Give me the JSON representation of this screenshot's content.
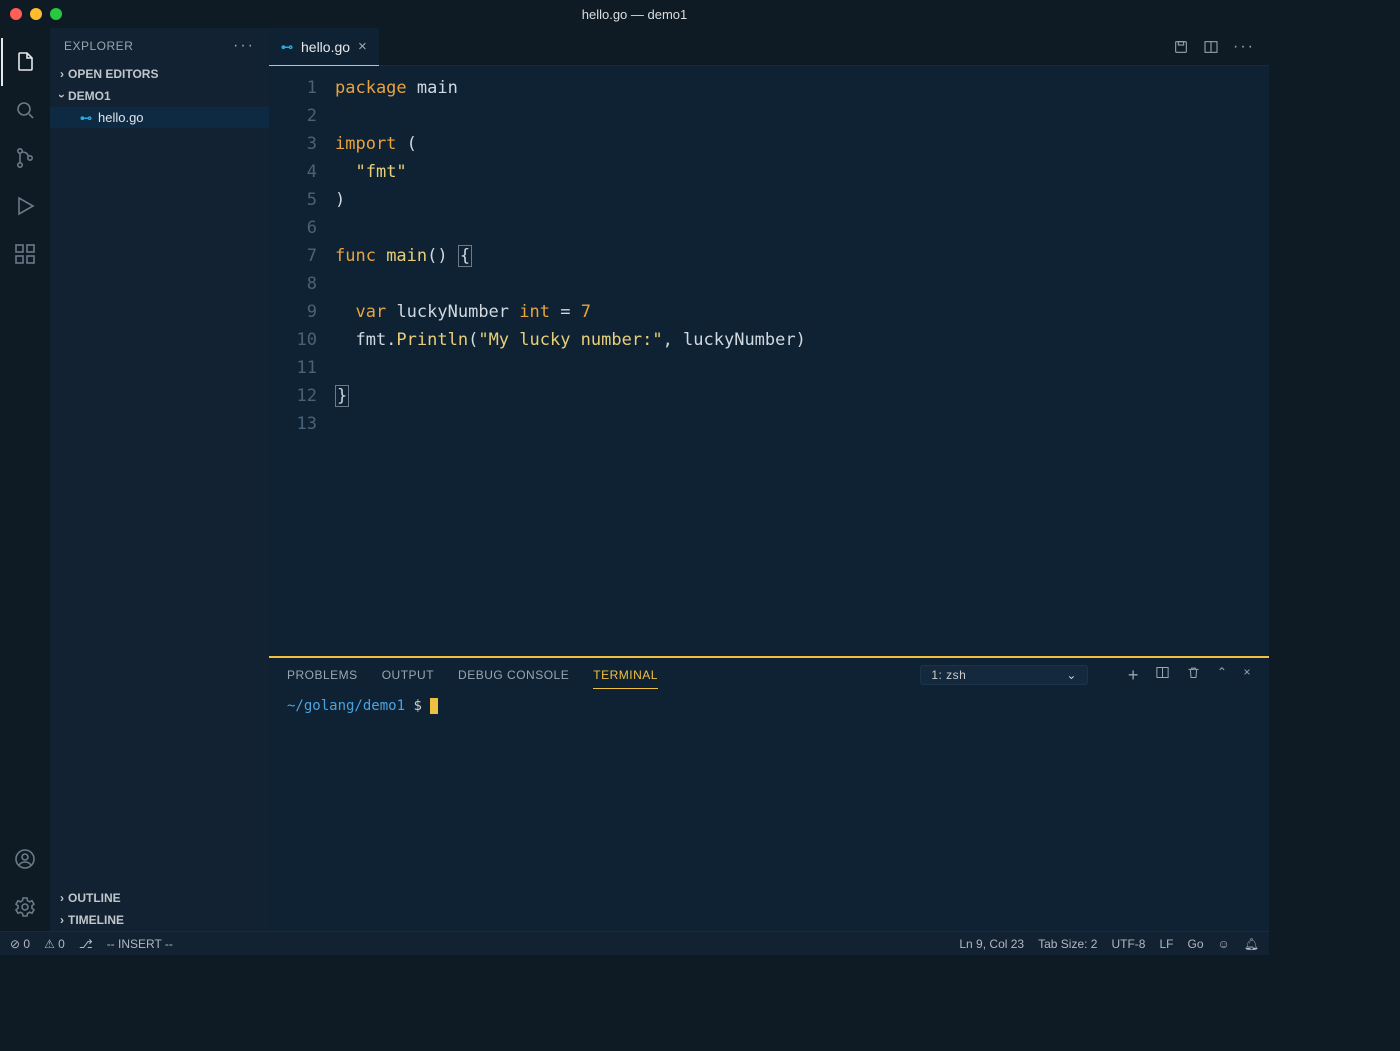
{
  "window": {
    "title": "hello.go — demo1"
  },
  "sidebar": {
    "title": "EXPLORER",
    "openEditors": "OPEN EDITORS",
    "project": "DEMO1",
    "file": "hello.go",
    "outline": "OUTLINE",
    "timeline": "TIMELINE"
  },
  "tab": {
    "name": "hello.go"
  },
  "code": {
    "lines": [
      [
        {
          "t": "package ",
          "c": "kw"
        },
        {
          "t": "main",
          "c": ""
        }
      ],
      [],
      [
        {
          "t": "import ",
          "c": "kw"
        },
        {
          "t": "(",
          "c": ""
        }
      ],
      [
        {
          "t": "  ",
          "c": ""
        },
        {
          "t": "\"fmt\"",
          "c": "str"
        }
      ],
      [
        {
          "t": ")",
          "c": ""
        }
      ],
      [],
      [
        {
          "t": "func ",
          "c": "kw"
        },
        {
          "t": "main",
          "c": "fn"
        },
        {
          "t": "() ",
          "c": ""
        },
        {
          "t": "{",
          "c": "",
          "box": true
        }
      ],
      [],
      [
        {
          "t": "  ",
          "c": ""
        },
        {
          "t": "var ",
          "c": "kw"
        },
        {
          "t": "luckyNumber ",
          "c": ""
        },
        {
          "t": "int",
          "c": "typ"
        },
        {
          "t": " = ",
          "c": ""
        },
        {
          "t": "7",
          "c": "num"
        }
      ],
      [
        {
          "t": "  fmt.",
          "c": ""
        },
        {
          "t": "Println",
          "c": "fn"
        },
        {
          "t": "(",
          "c": ""
        },
        {
          "t": "\"My lucky number:\"",
          "c": "str"
        },
        {
          "t": ", luckyNumber)",
          "c": ""
        }
      ],
      [],
      [
        {
          "t": "}",
          "c": "",
          "box": true
        }
      ],
      []
    ]
  },
  "panel": {
    "tabs": [
      "PROBLEMS",
      "OUTPUT",
      "DEBUG CONSOLE",
      "TERMINAL"
    ],
    "active": 3,
    "selector": "1: zsh",
    "terminalPath": "~/golang/demo1",
    "prompt": "$"
  },
  "status": {
    "errors": "0",
    "warnings": "0",
    "mode": "-- INSERT --",
    "pos": "Ln 9, Col 23",
    "tab": "Tab Size: 2",
    "enc": "UTF-8",
    "eol": "LF",
    "lang": "Go"
  }
}
